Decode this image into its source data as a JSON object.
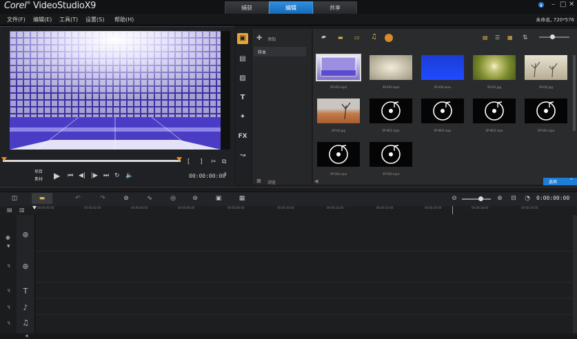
{
  "app": {
    "title": "Corel VideoStudio X9",
    "logo_word1": "Corel",
    "logo_word2": "VideoStudioX9",
    "project_info": "未命名, 720*576"
  },
  "steps": [
    {
      "label": "捕获",
      "active": false
    },
    {
      "label": "编辑",
      "active": true
    },
    {
      "label": "共享",
      "active": false
    }
  ],
  "menu": [
    "文件(F)",
    "编辑(E)",
    "工具(T)",
    "设置(S)",
    "帮助(H)"
  ],
  "player": {
    "mode_project": "项目",
    "mode_clip": "素材",
    "timecode": "00:00:00:00",
    "progress_fraction": 0.0
  },
  "library": {
    "add_label": "添加",
    "folder_sample": "样本",
    "browse_label": "浏览",
    "options_label": "选项",
    "thumbnails": [
      {
        "caption": "SP-V02.mp4",
        "kind": "video",
        "selected": true
      },
      {
        "caption": "SP-V03.mp4",
        "kind": "video",
        "selected": false
      },
      {
        "caption": "SP-V04.wmv",
        "kind": "video",
        "selected": false
      },
      {
        "caption": "SP-I01.jpg",
        "kind": "image",
        "selected": false
      },
      {
        "caption": "SP-I02.jpg",
        "kind": "image",
        "selected": false
      },
      {
        "caption": "SP-I03.jpg",
        "kind": "image",
        "selected": false
      },
      {
        "caption": "SP-M01.mpa",
        "kind": "audio",
        "selected": false
      },
      {
        "caption": "SP-M02.mpa",
        "kind": "audio",
        "selected": false
      },
      {
        "caption": "SP-M03.mpa",
        "kind": "audio",
        "selected": false
      },
      {
        "caption": "SP-S01.mpa",
        "kind": "audio",
        "selected": false
      },
      {
        "caption": "SP-S02.mpa",
        "kind": "audio",
        "selected": false
      },
      {
        "caption": "SP-S03.mpa",
        "kind": "audio",
        "selected": false
      }
    ]
  },
  "timeline": {
    "timecode": "0:00:00:00",
    "ticks": [
      "00:00:00:00",
      "00:00:02:00",
      "00:00:04:00",
      "00:00:06:00",
      "00:00:08:00",
      "00:00:10:00",
      "00:00:12:00",
      "00:00:14:00",
      "00:00:16:00",
      "00:00:18:00",
      "00:00:20:00"
    ]
  },
  "colors": {
    "accent": "#1e7dd6",
    "panel": "#2a2b2d"
  }
}
